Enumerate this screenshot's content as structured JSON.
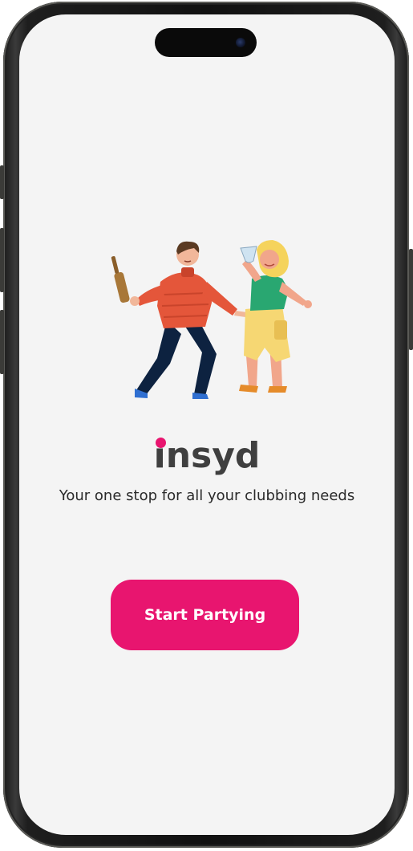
{
  "app": {
    "name": "insyd",
    "tagline": "Your one stop for all your clubbing needs",
    "accent_color": "#e8156f"
  },
  "hero": {
    "illustration": "dancing-couple-illustration"
  },
  "actions": {
    "primary_label": "Start Partying"
  }
}
